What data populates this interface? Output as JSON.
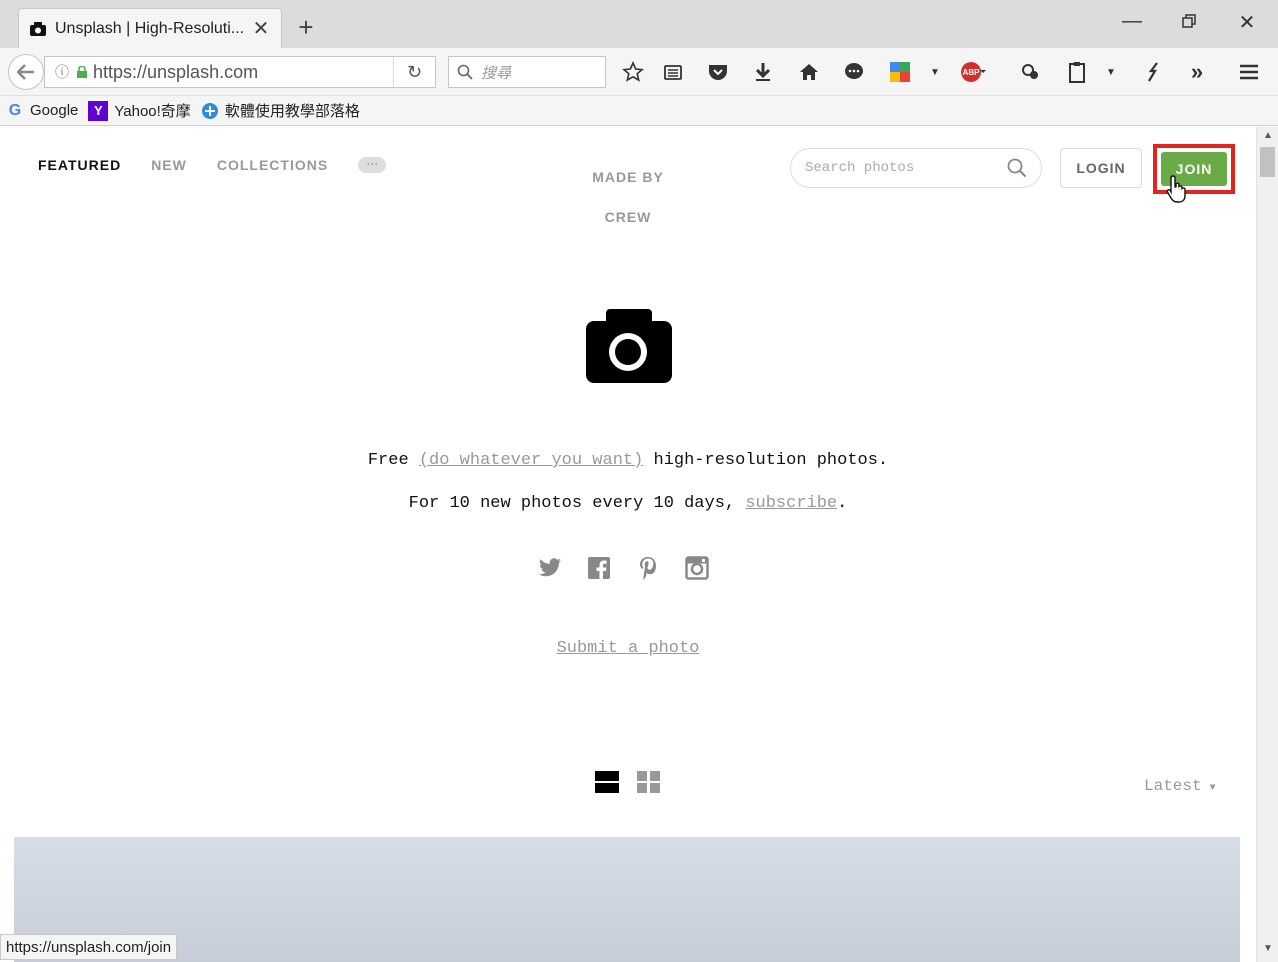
{
  "browser": {
    "tab_title": "Unsplash | High-Resoluti...",
    "url": "https://unsplash.com",
    "search_placeholder": "搜尋",
    "bookmarks": [
      "Google",
      "Yahoo!奇摩",
      "軟體使用教學部落格"
    ],
    "status_url": "https://unsplash.com/join"
  },
  "nav": {
    "featured": "FEATURED",
    "new": "NEW",
    "collections": "COLLECTIONS",
    "more": "···",
    "made_by": "MADE BY",
    "crew": "CREW",
    "search_placeholder": "Search photos",
    "login": "LOGIN",
    "join": "JOIN"
  },
  "hero": {
    "free": "Free",
    "do_whatever": "(do whatever you want)",
    "tagline_rest": "high-resolution photos.",
    "sub_pre": "For 10 new photos every 10 days,",
    "subscribe": "subscribe",
    "sub_post": ".",
    "submit": "Submit a photo"
  },
  "feed": {
    "sort": "Latest"
  },
  "colors": {
    "join_green": "#6aaa47",
    "highlight_red": "#e5231e"
  }
}
